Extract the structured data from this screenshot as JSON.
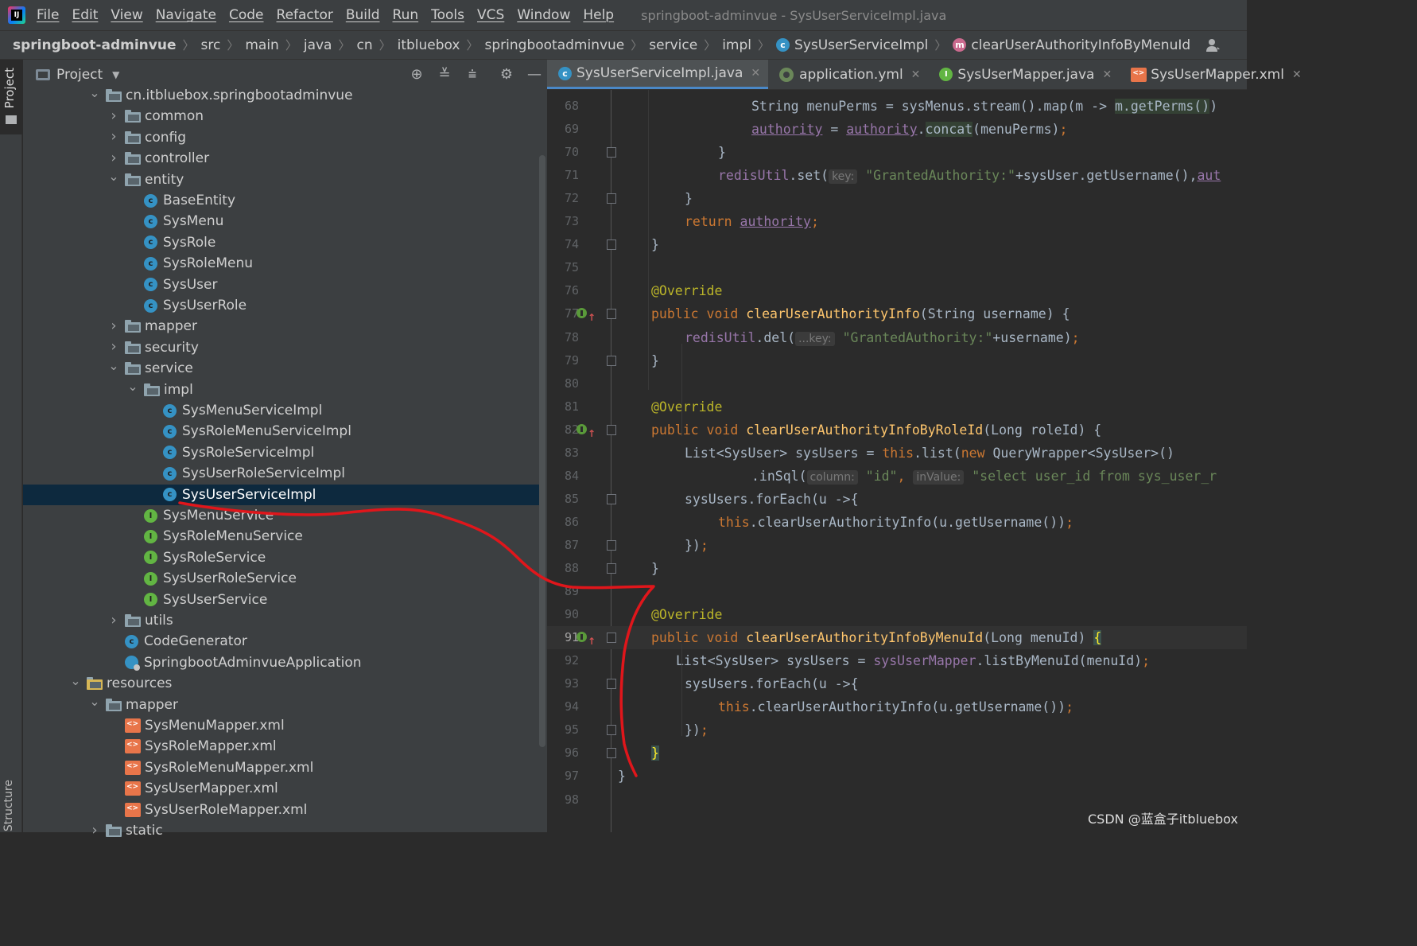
{
  "menu": {
    "items": [
      "File",
      "Edit",
      "View",
      "Navigate",
      "Code",
      "Refactor",
      "Build",
      "Run",
      "Tools",
      "VCS",
      "Window",
      "Help"
    ],
    "window_title": "springboot-adminvue - SysUserServiceImpl.java"
  },
  "breadcrumb": {
    "items": [
      "springboot-adminvue",
      "src",
      "main",
      "java",
      "cn",
      "itbluebox",
      "springbootadminvue",
      "service",
      "impl"
    ],
    "class_name": "SysUserServiceImpl",
    "method_name": "clearUserAuthorityInfoByMenuId"
  },
  "sidebar": {
    "project_tab": "Project",
    "structure_tab": "Structure"
  },
  "project_panel": {
    "title": "Project",
    "tree": [
      {
        "label": "cn.itbluebox.springbootadminvue",
        "type": "folder",
        "depth": 0,
        "open": true
      },
      {
        "label": "common",
        "type": "folder",
        "depth": 1,
        "open": false
      },
      {
        "label": "config",
        "type": "folder",
        "depth": 1,
        "open": false
      },
      {
        "label": "controller",
        "type": "folder",
        "depth": 1,
        "open": false
      },
      {
        "label": "entity",
        "type": "folder",
        "depth": 1,
        "open": true
      },
      {
        "label": "BaseEntity",
        "type": "class",
        "depth": 2
      },
      {
        "label": "SysMenu",
        "type": "class",
        "depth": 2
      },
      {
        "label": "SysRole",
        "type": "class",
        "depth": 2
      },
      {
        "label": "SysRoleMenu",
        "type": "class",
        "depth": 2
      },
      {
        "label": "SysUser",
        "type": "class",
        "depth": 2
      },
      {
        "label": "SysUserRole",
        "type": "class",
        "depth": 2
      },
      {
        "label": "mapper",
        "type": "folder",
        "depth": 1,
        "open": false
      },
      {
        "label": "security",
        "type": "folder",
        "depth": 1,
        "open": false
      },
      {
        "label": "service",
        "type": "folder",
        "depth": 1,
        "open": true
      },
      {
        "label": "impl",
        "type": "folder",
        "depth": 2,
        "open": true
      },
      {
        "label": "SysMenuServiceImpl",
        "type": "class",
        "depth": 3
      },
      {
        "label": "SysRoleMenuServiceImpl",
        "type": "class",
        "depth": 3
      },
      {
        "label": "SysRoleServiceImpl",
        "type": "class",
        "depth": 3
      },
      {
        "label": "SysUserRoleServiceImpl",
        "type": "class",
        "depth": 3
      },
      {
        "label": "SysUserServiceImpl",
        "type": "class",
        "depth": 3,
        "selected": true
      },
      {
        "label": "SysMenuService",
        "type": "interface",
        "depth": 2
      },
      {
        "label": "SysRoleMenuService",
        "type": "interface",
        "depth": 2
      },
      {
        "label": "SysRoleService",
        "type": "interface",
        "depth": 2
      },
      {
        "label": "SysUserRoleService",
        "type": "interface",
        "depth": 2
      },
      {
        "label": "SysUserService",
        "type": "interface",
        "depth": 2
      },
      {
        "label": "utils",
        "type": "folder",
        "depth": 1,
        "open": false
      },
      {
        "label": "CodeGenerator",
        "type": "class",
        "depth": 1
      },
      {
        "label": "SpringbootAdminvueApplication",
        "type": "app",
        "depth": 1
      },
      {
        "label": "resources",
        "type": "res-folder",
        "depth": -1,
        "open": true
      },
      {
        "label": "mapper",
        "type": "folder",
        "depth": 0,
        "open": true
      },
      {
        "label": "SysMenuMapper.xml",
        "type": "xml",
        "depth": 1
      },
      {
        "label": "SysRoleMapper.xml",
        "type": "xml",
        "depth": 1
      },
      {
        "label": "SysRoleMenuMapper.xml",
        "type": "xml",
        "depth": 1
      },
      {
        "label": "SysUserMapper.xml",
        "type": "xml",
        "depth": 1
      },
      {
        "label": "SysUserRoleMapper.xml",
        "type": "xml",
        "depth": 1
      },
      {
        "label": "static",
        "type": "folder",
        "depth": 0,
        "open": false
      }
    ]
  },
  "editor_tabs": [
    {
      "label": "SysUserServiceImpl.java",
      "kind": "class",
      "active": true
    },
    {
      "label": "application.yml",
      "kind": "yml",
      "active": false
    },
    {
      "label": "SysUserMapper.java",
      "kind": "interface",
      "active": false
    },
    {
      "label": "SysUserMapper.xml",
      "kind": "xml",
      "active": false
    }
  ],
  "code": {
    "current_line": 91,
    "override_lines": [
      77,
      82,
      91
    ],
    "fold_lines": [
      70,
      72,
      74,
      77,
      79,
      82,
      85,
      87,
      88,
      91,
      93,
      95,
      96
    ],
    "lines": [
      {
        "n": 68,
        "indent": 126,
        "tokens": [
          [
            "String menuPerms = sysMenus.stream().map(m -> ",
            ""
          ],
          [
            "m.getPerms()",
            "hl"
          ],
          [
            ")",
            ""
          ]
        ]
      },
      {
        "n": 69,
        "indent": 126,
        "tokens": [
          [
            "authority",
            "fld ul"
          ],
          [
            " = ",
            ""
          ],
          [
            "authority",
            "fld ul"
          ],
          [
            ".",
            ""
          ],
          [
            "concat",
            "hl"
          ],
          [
            "(menuPerms)",
            ""
          ],
          [
            ";",
            "kw"
          ]
        ]
      },
      {
        "n": 70,
        "indent": 84,
        "tokens": [
          [
            "}",
            ""
          ]
        ]
      },
      {
        "n": 71,
        "indent": 84,
        "tokens": [
          [
            "redisUtil",
            "fld"
          ],
          [
            ".set(",
            ""
          ],
          [
            "key:",
            "hint"
          ],
          [
            " ",
            ""
          ],
          [
            "\"GrantedAuthority:\"",
            "str"
          ],
          [
            "+sysUser.getUsername(),",
            ""
          ],
          [
            "aut",
            "fld ul"
          ]
        ]
      },
      {
        "n": 72,
        "indent": 42,
        "tokens": [
          [
            "}",
            ""
          ]
        ]
      },
      {
        "n": 73,
        "indent": 42,
        "tokens": [
          [
            "return ",
            "kw"
          ],
          [
            "authority",
            "fld ul"
          ],
          [
            ";",
            "kw"
          ]
        ]
      },
      {
        "n": 74,
        "indent": 0,
        "tokens": [
          [
            "}",
            ""
          ]
        ]
      },
      {
        "n": 75,
        "indent": 0,
        "tokens": []
      },
      {
        "n": 76,
        "indent": 0,
        "tokens": [
          [
            "@Override",
            "ann"
          ]
        ]
      },
      {
        "n": 77,
        "indent": 0,
        "tokens": [
          [
            "public void ",
            "kw"
          ],
          [
            "clearUserAuthorityInfo",
            "fn"
          ],
          [
            "(String username) {",
            ""
          ]
        ]
      },
      {
        "n": 78,
        "indent": 42,
        "tokens": [
          [
            "redisUtil",
            "fld"
          ],
          [
            ".del(",
            ""
          ],
          [
            "...key:",
            "hint"
          ],
          [
            " ",
            ""
          ],
          [
            "\"GrantedAuthority:\"",
            "str"
          ],
          [
            "+username)",
            ""
          ],
          [
            ";",
            "kw"
          ]
        ]
      },
      {
        "n": 79,
        "indent": 0,
        "tokens": [
          [
            "}",
            ""
          ]
        ]
      },
      {
        "n": 80,
        "indent": 0,
        "tokens": []
      },
      {
        "n": 81,
        "indent": 0,
        "tokens": [
          [
            "@Override",
            "ann"
          ]
        ]
      },
      {
        "n": 82,
        "indent": 0,
        "tokens": [
          [
            "public void ",
            "kw"
          ],
          [
            "clearUserAuthorityInfoByRoleId",
            "fn"
          ],
          [
            "(Long roleId) {",
            ""
          ]
        ]
      },
      {
        "n": 83,
        "indent": 42,
        "tokens": [
          [
            "List<SysUser> sysUsers = ",
            ""
          ],
          [
            "this",
            "kw"
          ],
          [
            ".list(",
            ""
          ],
          [
            "new ",
            "kw"
          ],
          [
            "QueryWrapper<SysUser>()",
            ""
          ]
        ]
      },
      {
        "n": 84,
        "indent": 126,
        "tokens": [
          [
            ".inSql(",
            ""
          ],
          [
            "column:",
            "hint"
          ],
          [
            " ",
            ""
          ],
          [
            "\"id\"",
            "str"
          ],
          [
            ", ",
            "kw"
          ],
          [
            "inValue:",
            "hint"
          ],
          [
            " ",
            ""
          ],
          [
            "\"select user_id from sys_user_r",
            "str"
          ]
        ]
      },
      {
        "n": 85,
        "indent": 42,
        "tokens": [
          [
            "sysUsers.forEach(u ->{",
            ""
          ]
        ]
      },
      {
        "n": 86,
        "indent": 84,
        "tokens": [
          [
            "this",
            "kw"
          ],
          [
            ".clearUserAuthorityInfo(u.getUsername())",
            ""
          ],
          [
            ";",
            "kw"
          ]
        ]
      },
      {
        "n": 87,
        "indent": 42,
        "tokens": [
          [
            "})",
            ""
          ],
          [
            ";",
            "kw"
          ]
        ]
      },
      {
        "n": 88,
        "indent": 0,
        "tokens": [
          [
            "}",
            ""
          ]
        ]
      },
      {
        "n": 89,
        "indent": 0,
        "tokens": []
      },
      {
        "n": 90,
        "indent": 0,
        "tokens": [
          [
            "@Override",
            "ann"
          ]
        ]
      },
      {
        "n": 91,
        "indent": 0,
        "tokens": [
          [
            "public void ",
            "kw"
          ],
          [
            "clearUserAuthorityInfoByMenuId",
            "fn"
          ],
          [
            "(Long menuId) ",
            ""
          ],
          [
            "{",
            "brace-hl"
          ]
        ]
      },
      {
        "n": 92,
        "indent": 31,
        "tokens": [
          [
            "List<SysUser> sysUsers = ",
            ""
          ],
          [
            "sysUserMapper",
            "fld"
          ],
          [
            ".listByMenuId(menuId)",
            ""
          ],
          [
            ";",
            "kw"
          ]
        ]
      },
      {
        "n": 93,
        "indent": 42,
        "tokens": [
          [
            "sysUsers.forEach(u ->{",
            ""
          ]
        ]
      },
      {
        "n": 94,
        "indent": 84,
        "tokens": [
          [
            "this",
            "kw"
          ],
          [
            ".clearUserAuthorityInfo(u.getUsername())",
            ""
          ],
          [
            ";",
            "kw"
          ]
        ]
      },
      {
        "n": 95,
        "indent": 42,
        "tokens": [
          [
            "})",
            ""
          ],
          [
            ";",
            "kw"
          ]
        ]
      },
      {
        "n": 96,
        "indent": 0,
        "tokens": [
          [
            "}",
            "brace-hl"
          ]
        ]
      },
      {
        "n": 97,
        "indent": -42,
        "tokens": [
          [
            "}",
            ""
          ]
        ]
      },
      {
        "n": 98,
        "indent": 0,
        "tokens": []
      }
    ]
  },
  "watermark": "CSDN @蓝盒子itbluebox",
  "colors": {
    "annotation_stroke": "#e0161b",
    "selection": "#0d293e",
    "keyword": "#cc7832",
    "method": "#ffc66d",
    "string": "#6a8759",
    "field": "#9876aa",
    "annotation": "#bbb529"
  }
}
